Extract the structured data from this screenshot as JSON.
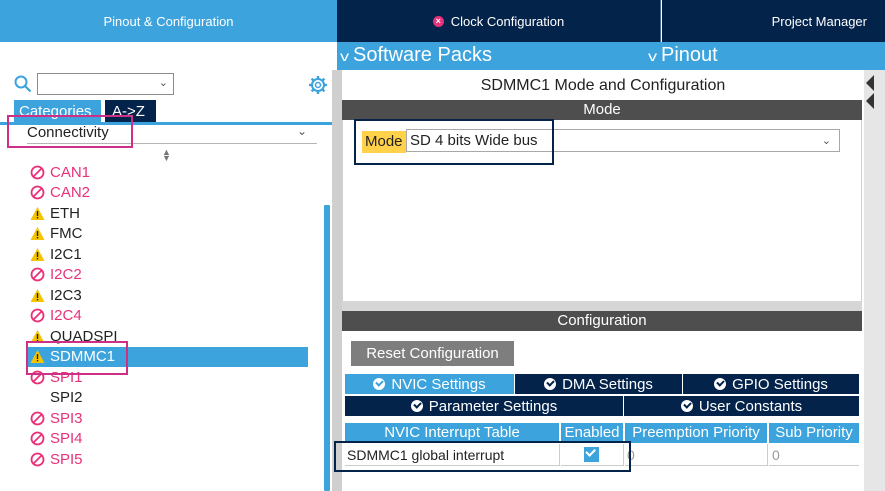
{
  "top_tabs": {
    "pinout": "Pinout & Configuration",
    "clock": "Clock Configuration",
    "project": "Project Manager"
  },
  "menubar": {
    "software_packs": "Software Packs",
    "pinout": "Pinout"
  },
  "left": {
    "search_value": "",
    "tabs": {
      "categories": "Categories",
      "az": "A->Z"
    },
    "category_selected": "Connectivity",
    "items": [
      {
        "label": "CAN1",
        "status": "disabled"
      },
      {
        "label": "CAN2",
        "status": "disabled"
      },
      {
        "label": "ETH",
        "status": "warning"
      },
      {
        "label": "FMC",
        "status": "warning"
      },
      {
        "label": "I2C1",
        "status": "warning"
      },
      {
        "label": "I2C2",
        "status": "disabled"
      },
      {
        "label": "I2C3",
        "status": "warning"
      },
      {
        "label": "I2C4",
        "status": "disabled"
      },
      {
        "label": "QUADSPI",
        "status": "warning"
      },
      {
        "label": "SDMMC1",
        "status": "warning-selected"
      },
      {
        "label": "SPI1",
        "status": "disabled"
      },
      {
        "label": "SPI2",
        "status": "none"
      },
      {
        "label": "SPI3",
        "status": "disabled"
      },
      {
        "label": "SPI4",
        "status": "disabled"
      },
      {
        "label": "SPI5",
        "status": "disabled"
      }
    ]
  },
  "right": {
    "title": "SDMMC1 Mode and Configuration",
    "mode_header": "Mode",
    "mode_label": "Mode",
    "mode_value": "SD 4 bits Wide bus",
    "config_header": "Configuration",
    "reset_button": "Reset Configuration",
    "config_tabs_row1": [
      "NVIC Settings",
      "DMA Settings",
      "GPIO Settings"
    ],
    "config_tabs_row2": [
      "Parameter Settings",
      "User Constants"
    ],
    "table": {
      "headers": [
        "NVIC Interrupt Table",
        "Enabled",
        "Preemption Priority",
        "Sub Priority"
      ],
      "rows": [
        {
          "name": "SDMMC1 global interrupt",
          "enabled": true,
          "preemption": "0",
          "sub": "0"
        }
      ]
    }
  },
  "colors": {
    "accent_blue": "#3ca3dd",
    "navy": "#03234b",
    "disabled_pink": "#e8317a",
    "warning_yellow": "#f5c400",
    "annotation_magenta": "#d02f86"
  }
}
